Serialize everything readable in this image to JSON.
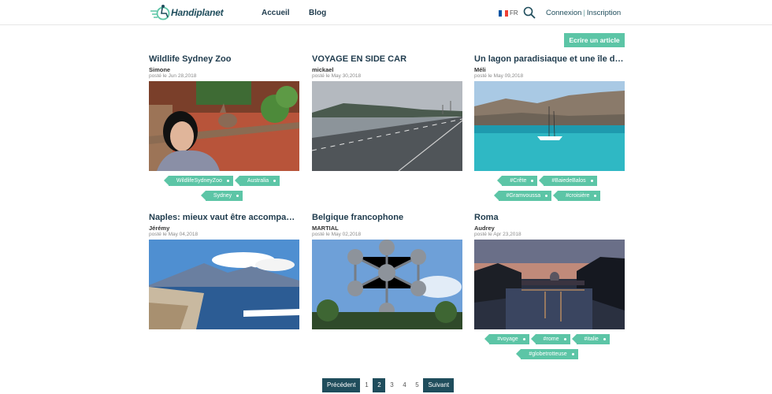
{
  "header": {
    "logo_text": "Handiplanet",
    "nav": [
      {
        "label": "Accueil"
      },
      {
        "label": "Blog"
      }
    ],
    "lang": "FR",
    "login": "Connexion",
    "separator": "|",
    "signup": "Inscription"
  },
  "write_button": "Ecrire un article",
  "articles": [
    {
      "title": "Wildlife Sydney Zoo",
      "author": "Simone",
      "date": "posté le Jun 28,2018",
      "tags": [
        "WildlifeSydneyZoo",
        "Australia",
        "Sydney"
      ]
    },
    {
      "title": "VOYAGE EN SIDE CAR",
      "author": "mickael",
      "date": "posté le May 30,2018",
      "tags": []
    },
    {
      "title": "Un lagon paradisiaque et une île de rêve en Crète",
      "author": "Méli",
      "date": "posté le May 09,2018",
      "tags": [
        "#Crête",
        "#BaiedeBalos",
        "#Gramvoussa",
        "#croisière"
      ]
    },
    {
      "title": "Naples: mieux vaut être accompagné pour découvrir",
      "author": "Jérémy",
      "date": "posté le May 04,2018",
      "tags": []
    },
    {
      "title": "Belgique francophone",
      "author": "MARTIAL",
      "date": "posté le May 02,2018",
      "tags": []
    },
    {
      "title": "Roma",
      "author": "Audrey",
      "date": "posté le Apr 23,2018",
      "tags": [
        "#voyage",
        "#rome",
        "#italie",
        "#globetrotteuse"
      ]
    }
  ],
  "pagination": {
    "prev": "Précédent",
    "pages": [
      "1",
      "2",
      "3",
      "4",
      "5"
    ],
    "current": "2",
    "next": "Suivant"
  },
  "colors": {
    "accent": "#5cc5a6",
    "dark": "#1f4d5c",
    "text": "#1f3b4d"
  }
}
